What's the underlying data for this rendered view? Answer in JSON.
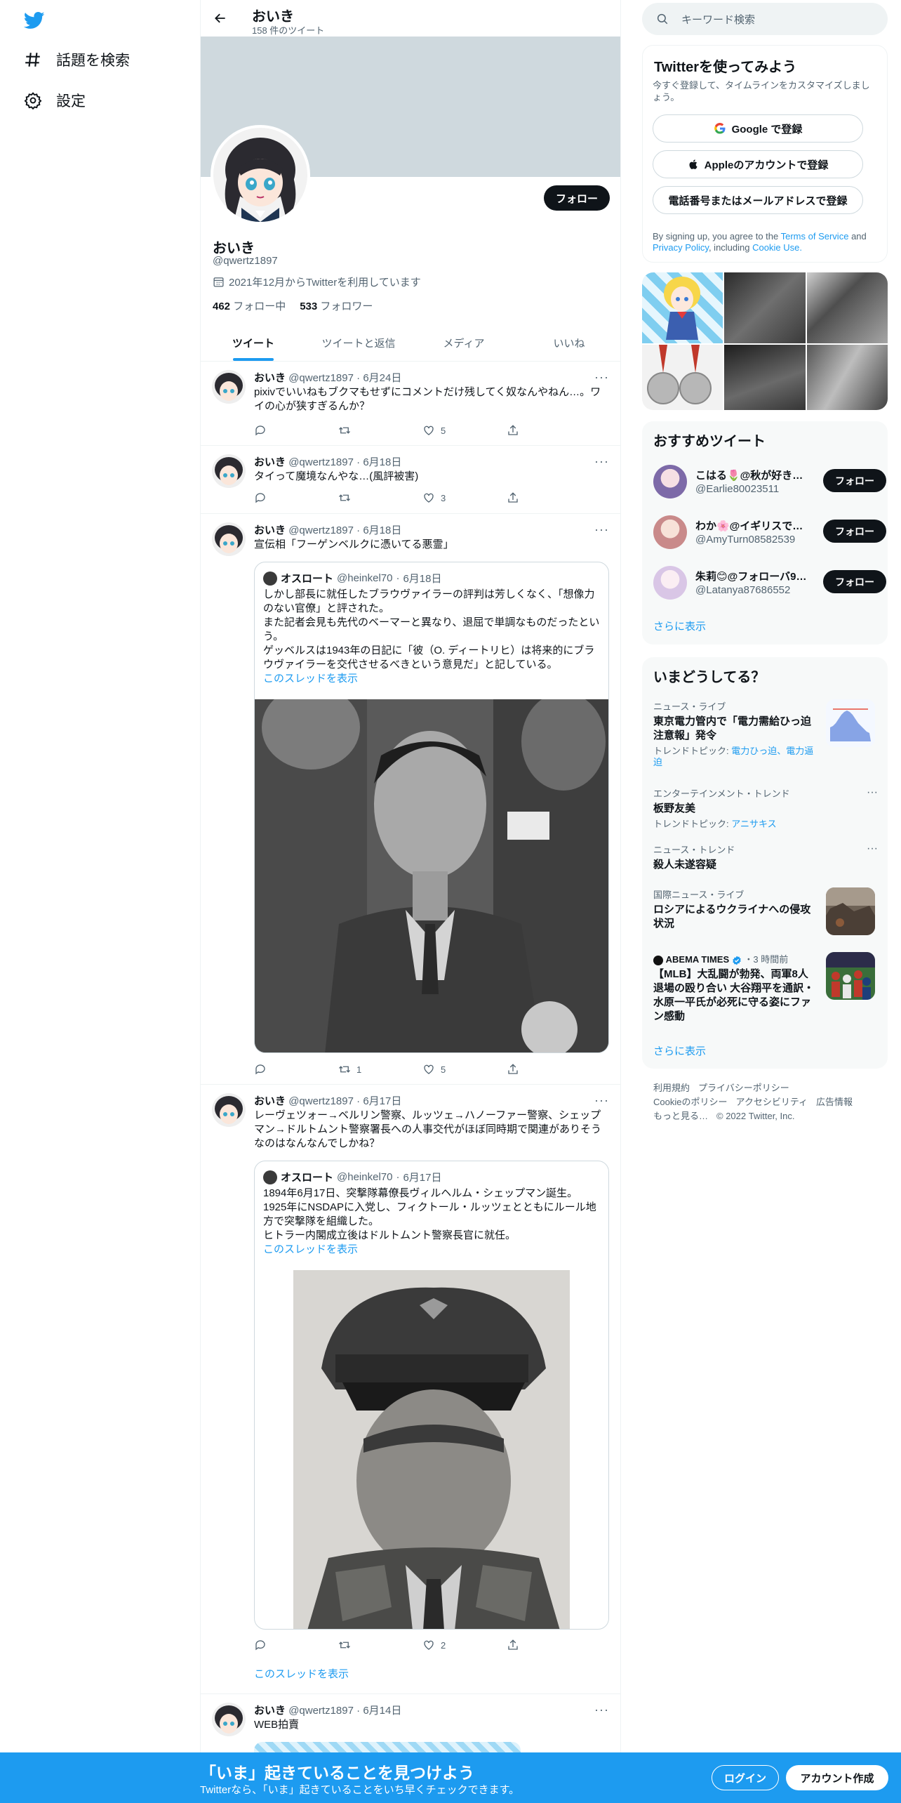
{
  "nav": {
    "items": [
      {
        "label": "話題を検索",
        "icon": "hashtag-icon"
      },
      {
        "label": "設定",
        "icon": "gear-icon"
      }
    ]
  },
  "profile": {
    "header_name": "おいき",
    "tweet_count": "158 件のツイート",
    "name": "おいき",
    "handle": "@qwertz1897",
    "joined": "2021年12月からTwitterを利用しています",
    "following_count": "462",
    "following_label": "フォロー中",
    "followers_count": "533",
    "followers_label": "フォロワー",
    "follow_label": "フォロー"
  },
  "tabs": [
    "ツイート",
    "ツイートと返信",
    "メディア",
    "いいね"
  ],
  "tweets": [
    {
      "name": "おいき",
      "handle": "@qwertz1897",
      "date": "6月24日",
      "text": "pixivでいいねもブクマもせずにコメントだけ残してく奴なんやねん…。ワイの心が狭すぎるんか？",
      "replies": "",
      "retweets": "",
      "likes": "5"
    },
    {
      "name": "おいき",
      "handle": "@qwertz1897",
      "date": "6月18日",
      "text": "タイって魔境なんやな…(風評被害)",
      "replies": "",
      "retweets": "",
      "likes": "3"
    },
    {
      "name": "おいき",
      "handle": "@qwertz1897",
      "date": "6月18日",
      "text": "宣伝相「フーゲンベルクに憑いてる悪霊」",
      "quote": {
        "name": "オスロート",
        "handle": "@heinkel70",
        "date": "6月18日",
        "text": "しかし部長に就任したブラウヴァイラーの評判は芳しくなく、「想像力のない官僚」と評された。\nまた記者会見も先代のベーマーと異なり、退屈で単調なものだったという。\nゲッベルスは1943年の日記に「彼（O. ディートリヒ）は将来的にブラウヴァイラーを交代させるべきという意見だ」と記している。",
        "thread_link": "このスレッドを表示"
      },
      "replies": "",
      "retweets": "1",
      "likes": "5"
    },
    {
      "name": "おいき",
      "handle": "@qwertz1897",
      "date": "6月17日",
      "text": "レーヴェツォー→ベルリン警察、ルッツェ→ハノーファー警察、シェップマン→ドルトムント警察署長への人事交代がほぼ同時期で関連がありそうなのはなんなんでしかね？",
      "quote": {
        "name": "オスロート",
        "handle": "@heinkel70",
        "date": "6月17日",
        "text": "1894年6月17日、突撃隊幕僚長ヴィルヘルム・シェップマン誕生。\n1925年にNSDAPに入党し、フィクトール・ルッツェとともにルール地方で突撃隊を組織した。\nヒトラー内閣成立後はドルトムント警察長官に就任。",
        "thread_link": "このスレッドを表示"
      },
      "replies": "",
      "retweets": "",
      "likes": "2",
      "thread_link": "このスレッドを表示"
    },
    {
      "name": "おいき",
      "handle": "@qwertz1897",
      "date": "6月14日",
      "text": "WEB拍賣"
    }
  ],
  "right": {
    "search_placeholder": "キーワード検索",
    "signup": {
      "title": "Twitterを使ってみよう",
      "subtitle": "今すぐ登録して、タイムラインをカスタマイズしましょう。",
      "google": "Google で登録",
      "apple": "Appleのアカウントで登録",
      "phone": "電話番号またはメールアドレスで登録",
      "legal_1": "By signing up, you agree to the",
      "tos": "Terms of Service",
      "and": "and",
      "privacy": "Privacy Policy",
      "including": ", including",
      "cookie": "Cookie Use."
    },
    "recommended": {
      "title": "おすすめツイート",
      "users": [
        {
          "name": "こはる🌷@秋が好き…",
          "handle": "@Earlie80023511",
          "button": "フォロー"
        },
        {
          "name": "わか🌸@イギリスで…",
          "handle": "@AmyTurn08582539",
          "button": "フォロー"
        },
        {
          "name": "朱莉😊@フォローバ93…",
          "handle": "@Latanya87686552",
          "button": "フォロー"
        }
      ],
      "more": "さらに表示"
    },
    "trends": {
      "title": "いまどうしてる？",
      "items": [
        {
          "context": "ニュース・ライブ",
          "title": "東京電力管内で「電力需給ひっ迫注意報」発令",
          "topic_label": "トレンドトピック:",
          "topic": "電力ひっ迫、電力逼迫"
        },
        {
          "context": "エンターテインメント・トレンド",
          "title": "板野友美",
          "topic_label": "トレンドトピック:",
          "topic": "アニサキス"
        },
        {
          "context": "ニュース・トレンド",
          "title": "殺人未遂容疑"
        },
        {
          "context": "国際ニュース・ライブ",
          "title": "ロシアによるウクライナへの侵攻状況"
        },
        {
          "context_source": "ABEMA TIMES",
          "context_time": "・3 時間前",
          "title": "【MLB】大乱闘が勃発、両軍8人退場の殴り合い 大谷翔平を通訳・水原一平氏が必死に守る姿にファン感動"
        }
      ],
      "more": "さらに表示"
    },
    "footer": {
      "links": [
        "利用規約",
        "プライバシーポリシー",
        "Cookieのポリシー",
        "アクセシビリティ",
        "広告情報",
        "もっと見る…"
      ],
      "copyright": "© 2022 Twitter, Inc."
    }
  },
  "bottom": {
    "title": "「いま」起きていることを見つけよう",
    "subtitle": "Twitterなら、「いま」起きていることをいち早くチェックできます。",
    "login": "ログイン",
    "signup": "アカウント作成"
  },
  "colors": {
    "accent": "#1d9bf0",
    "text": "#0f1419",
    "muted": "#536471",
    "banner": "#cfd9de"
  }
}
